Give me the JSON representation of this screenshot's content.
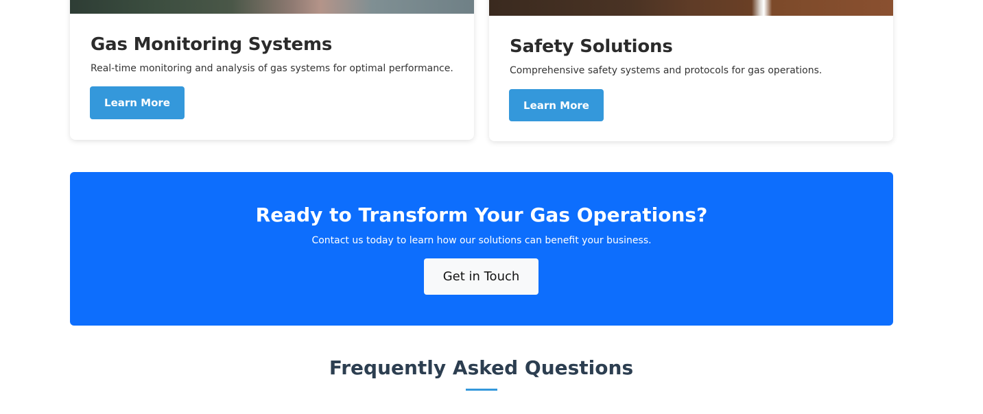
{
  "cards": [
    {
      "title": "Gas Monitoring Systems",
      "description": "Real-time monitoring and analysis of gas systems for optimal performance.",
      "button_label": "Learn More"
    },
    {
      "title": "Safety Solutions",
      "description": "Comprehensive safety systems and protocols for gas operations.",
      "button_label": "Learn More"
    }
  ],
  "cta": {
    "title": "Ready to Transform Your Gas Operations?",
    "subtitle": "Contact us today to learn how our solutions can benefit your business.",
    "button_label": "Get in Touch"
  },
  "faq": {
    "title": "Frequently Asked Questions"
  },
  "colors": {
    "primary_button": "#3498db",
    "cta_background": "#0d6efd",
    "heading_text": "#2c3e50"
  }
}
